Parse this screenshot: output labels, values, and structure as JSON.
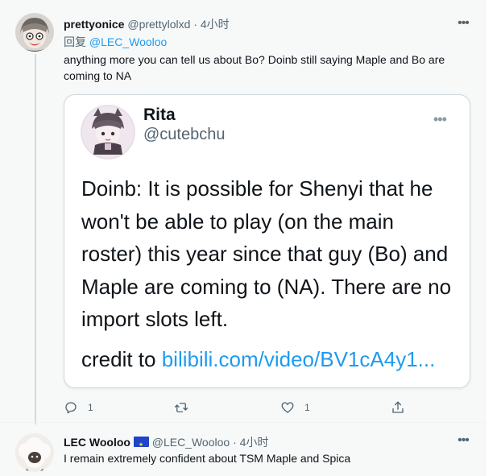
{
  "tweet1": {
    "name": "prettyonice",
    "handle": "@prettylolxd",
    "dot": "·",
    "time": "4小时",
    "replying_label": "回复",
    "replying_mention": "@LEC_Wooloo",
    "text": "anything more you can tell us about Bo? Doinb still saying Maple and Bo are coming to NA",
    "more": "•••",
    "quote": {
      "name": "Rita",
      "handle": "@cutebchu",
      "more": "•••",
      "text": "Doinb: It is possible for Shenyi that he won't be able to play (on the main roster) this year since that guy (Bo) and Maple are coming to (NA). There are no import slots left.",
      "credit_prefix": "credit to ",
      "credit_link": "bilibili.com/video/BV1cA4y1..."
    },
    "actions": {
      "reply_count": "1",
      "like_count": "1"
    }
  },
  "tweet2": {
    "name": "LEC Wooloo",
    "handle": "@LEC_Wooloo",
    "dot": "·",
    "time": "4小时",
    "more": "•••",
    "text": "I remain extremely confident about TSM Maple and Spica"
  },
  "colors": {
    "accent": "#1d9bf0",
    "secondary_text": "#536471",
    "primary_text": "#0f1419",
    "eu_flag_blue": "#1f44c8"
  },
  "icons": [
    "reply-icon",
    "retweet-icon",
    "like-icon",
    "share-icon",
    "more-icon",
    "eu-flag-icon"
  ]
}
